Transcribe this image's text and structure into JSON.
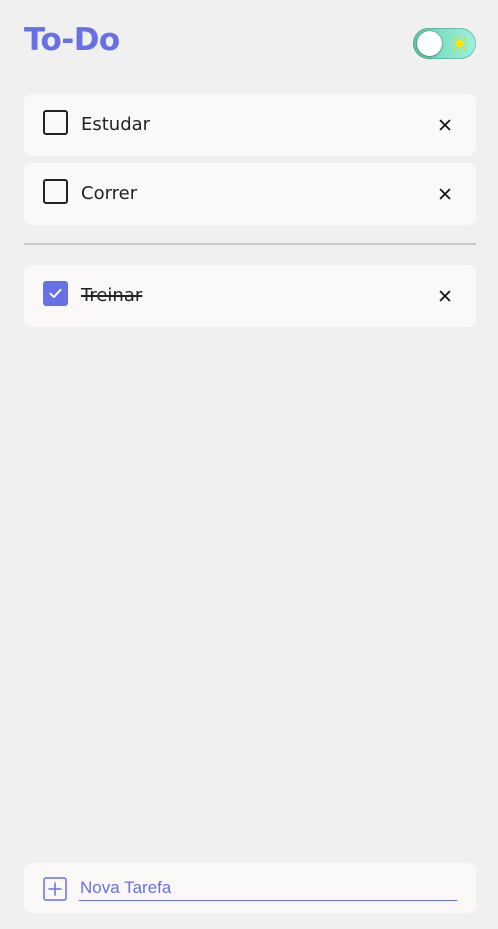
{
  "app": {
    "title": "To-Do",
    "accent_color": "#6870e6"
  },
  "theme_toggle": {
    "state": "light",
    "icon": "sun-icon"
  },
  "tasks": [
    {
      "label": "Estudar",
      "done": false
    },
    {
      "label": "Correr",
      "done": false
    }
  ],
  "completed_tasks": [
    {
      "label": "Treinar",
      "done": true
    }
  ],
  "new_task": {
    "placeholder": "Nova Tarefa",
    "value": ""
  }
}
